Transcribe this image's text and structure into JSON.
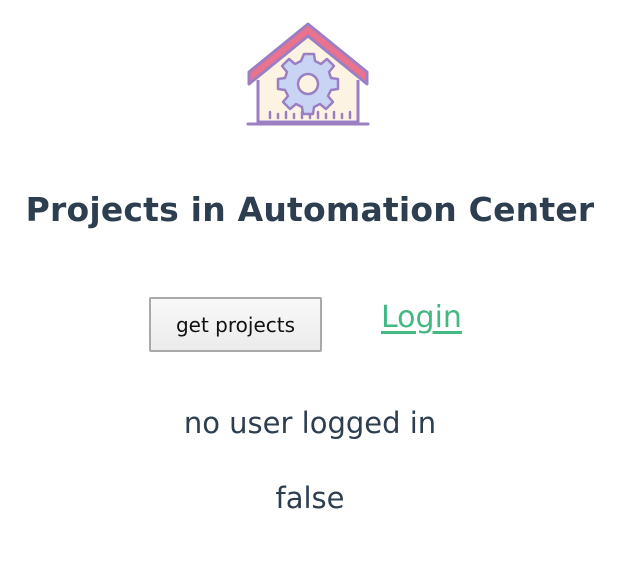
{
  "header": {
    "logo_icon": "house-gear-icon",
    "title": "Projects in Automation Center"
  },
  "actions": {
    "get_projects_label": "get projects",
    "login_label": "Login"
  },
  "status": {
    "user_text": "no user logged in",
    "flag_text": "false"
  },
  "colors": {
    "text": "#2c3e50",
    "link": "#42b983",
    "roof": "#e9728f",
    "house_outline": "#9b7fc2",
    "gear_fill": "#c9d4f5"
  }
}
